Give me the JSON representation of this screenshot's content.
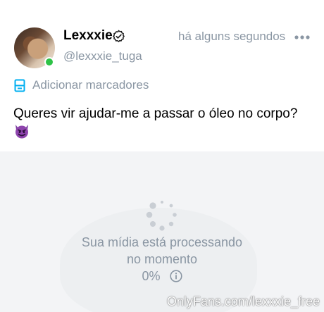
{
  "post": {
    "author_name": "Lexxxie",
    "author_handle": "@lexxxie_tuga",
    "timestamp": "há alguns segundos",
    "bookmark_label": "Adicionar marcadores",
    "caption": "Queres vir ajudar-me a passar o óleo no corpo?",
    "caption_emoji": "smiling-imp-icon",
    "online_status_color": "#2ec246",
    "verified": true
  },
  "media": {
    "processing_text": "Sua mídia está processando no momento",
    "progress_label": "0%",
    "progress_value": 0
  },
  "watermark": "OnlyFans.com/lexxxie_free",
  "colors": {
    "accent": "#00aff0",
    "muted_text": "#8a96a3",
    "media_background": "#f3f4f6"
  }
}
